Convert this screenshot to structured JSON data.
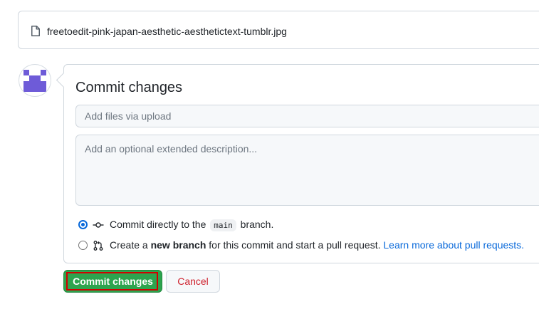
{
  "file": {
    "icon": "file-icon",
    "name": "freetoedit-pink-japan-aesthetic-aesthetictext-tumblr.jpg"
  },
  "avatar": {
    "icon": "identicon-avatar",
    "color": "#6e5bd8"
  },
  "commit": {
    "title": "Commit changes",
    "summary_placeholder": "Add files via upload",
    "summary_value": "",
    "description_placeholder": "Add an optional extended description...",
    "description_value": "",
    "options": {
      "direct": {
        "checked": true,
        "icon": "git-commit-icon",
        "prefix": "Commit directly to the",
        "branch": "main",
        "suffix": "branch."
      },
      "new_branch": {
        "checked": false,
        "icon": "git-pull-request-icon",
        "prefix": "Create a",
        "bold": "new branch",
        "middle": "for this commit and start a pull request.",
        "link": "Learn more about pull requests."
      }
    }
  },
  "buttons": {
    "commit_label": "Commit changes",
    "cancel_label": "Cancel"
  },
  "colors": {
    "accent_blue": "#0969da",
    "primary_green": "#2da44e",
    "danger_red": "#cf222e",
    "highlight_border": "#d10000"
  }
}
